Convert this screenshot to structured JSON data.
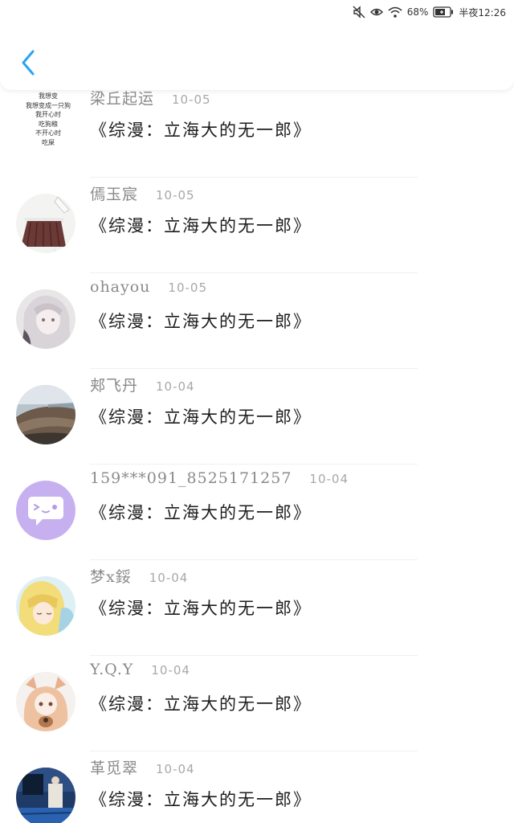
{
  "status_bar": {
    "battery": "68%",
    "time": "半夜12:26",
    "icons": [
      "mute-icon",
      "eye-comfort-icon",
      "wifi-icon",
      "battery-icon"
    ]
  },
  "header": {
    "back_icon": "chevron-left-icon",
    "accent_color": "#2aa3f5"
  },
  "first_avatar_text": [
    "我想变",
    "我想变成一只狗",
    "我开心时",
    "吃狗粮",
    "不开心时",
    "吃屎"
  ],
  "items": [
    {
      "name": "梁丘起运",
      "date": "10-05",
      "content": "《综漫：立海大的无一郎》"
    },
    {
      "name": "傿玉宸",
      "date": "10-05",
      "content": "《综漫：立海大的无一郎》"
    },
    {
      "name": "ohayou",
      "date": "10-05",
      "content": "《综漫：立海大的无一郎》"
    },
    {
      "name": "郏飞丹",
      "date": "10-04",
      "content": "《综漫：立海大的无一郎》"
    },
    {
      "name": "159***091_8525171257",
      "date": "10-04",
      "content": "《综漫：立海大的无一郎》"
    },
    {
      "name": "梦x鋖",
      "date": "10-04",
      "content": "《综漫：立海大的无一郎》"
    },
    {
      "name": "Y.Q.Y",
      "date": "10-04",
      "content": "《综漫：立海大的无一郎》"
    },
    {
      "name": "革觅翠",
      "date": "10-04",
      "content": "《综漫：立海大的无一郎》"
    }
  ]
}
